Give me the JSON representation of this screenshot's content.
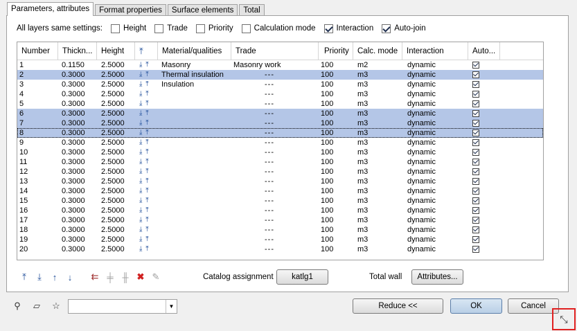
{
  "tabs": [
    "Parameters, attributes",
    "Format properties",
    "Surface elements",
    "Total"
  ],
  "settings": {
    "label": "All layers same settings:",
    "options": [
      {
        "label": "Height",
        "checked": false
      },
      {
        "label": "Trade",
        "checked": false
      },
      {
        "label": "Priority",
        "checked": false
      },
      {
        "label": "Calculation mode",
        "checked": false
      },
      {
        "label": "Interaction",
        "checked": true
      },
      {
        "label": "Auto-join",
        "checked": true
      }
    ]
  },
  "table": {
    "headers": [
      "Number",
      "Thickn...",
      "Height",
      "",
      "Material/qualities",
      "Trade",
      "Priority",
      "Calc. mode",
      "Interaction",
      "Auto..."
    ],
    "rows": [
      {
        "num": "1",
        "th": "0.1150",
        "h": "2.5000",
        "mat": "Masonry",
        "trade": "Masonry work",
        "pr": "100",
        "cm": "m2",
        "int": "dynamic",
        "sel": false
      },
      {
        "num": "2",
        "th": "0.3000",
        "h": "2.5000",
        "mat": "Thermal insulation",
        "trade": "---",
        "pr": "100",
        "cm": "m3",
        "int": "dynamic",
        "sel": true
      },
      {
        "num": "3",
        "th": "0.3000",
        "h": "2.5000",
        "mat": "Insulation",
        "trade": "---",
        "pr": "100",
        "cm": "m3",
        "int": "dynamic",
        "sel": false
      },
      {
        "num": "4",
        "th": "0.3000",
        "h": "2.5000",
        "mat": "",
        "trade": "---",
        "pr": "100",
        "cm": "m3",
        "int": "dynamic",
        "sel": false
      },
      {
        "num": "5",
        "th": "0.3000",
        "h": "2.5000",
        "mat": "",
        "trade": "---",
        "pr": "100",
        "cm": "m3",
        "int": "dynamic",
        "sel": false
      },
      {
        "num": "6",
        "th": "0.3000",
        "h": "2.5000",
        "mat": "",
        "trade": "---",
        "pr": "100",
        "cm": "m3",
        "int": "dynamic",
        "sel": true
      },
      {
        "num": "7",
        "th": "0.3000",
        "h": "2.5000",
        "mat": "",
        "trade": "---",
        "pr": "100",
        "cm": "m3",
        "int": "dynamic",
        "sel": true
      },
      {
        "num": "8",
        "th": "0.3000",
        "h": "2.5000",
        "mat": "",
        "trade": "---",
        "pr": "100",
        "cm": "m3",
        "int": "dynamic",
        "sel": true,
        "focus": true
      },
      {
        "num": "9",
        "th": "0.3000",
        "h": "2.5000",
        "mat": "",
        "trade": "---",
        "pr": "100",
        "cm": "m3",
        "int": "dynamic",
        "sel": false
      },
      {
        "num": "10",
        "th": "0.3000",
        "h": "2.5000",
        "mat": "",
        "trade": "---",
        "pr": "100",
        "cm": "m3",
        "int": "dynamic",
        "sel": false
      },
      {
        "num": "11",
        "th": "0.3000",
        "h": "2.5000",
        "mat": "",
        "trade": "---",
        "pr": "100",
        "cm": "m3",
        "int": "dynamic",
        "sel": false
      },
      {
        "num": "12",
        "th": "0.3000",
        "h": "2.5000",
        "mat": "",
        "trade": "---",
        "pr": "100",
        "cm": "m3",
        "int": "dynamic",
        "sel": false
      },
      {
        "num": "13",
        "th": "0.3000",
        "h": "2.5000",
        "mat": "",
        "trade": "---",
        "pr": "100",
        "cm": "m3",
        "int": "dynamic",
        "sel": false
      },
      {
        "num": "14",
        "th": "0.3000",
        "h": "2.5000",
        "mat": "",
        "trade": "---",
        "pr": "100",
        "cm": "m3",
        "int": "dynamic",
        "sel": false
      },
      {
        "num": "15",
        "th": "0.3000",
        "h": "2.5000",
        "mat": "",
        "trade": "---",
        "pr": "100",
        "cm": "m3",
        "int": "dynamic",
        "sel": false
      },
      {
        "num": "16",
        "th": "0.3000",
        "h": "2.5000",
        "mat": "",
        "trade": "---",
        "pr": "100",
        "cm": "m3",
        "int": "dynamic",
        "sel": false
      },
      {
        "num": "17",
        "th": "0.3000",
        "h": "2.5000",
        "mat": "",
        "trade": "---",
        "pr": "100",
        "cm": "m3",
        "int": "dynamic",
        "sel": false
      },
      {
        "num": "18",
        "th": "0.3000",
        "h": "2.5000",
        "mat": "",
        "trade": "---",
        "pr": "100",
        "cm": "m3",
        "int": "dynamic",
        "sel": false
      },
      {
        "num": "19",
        "th": "0.3000",
        "h": "2.5000",
        "mat": "",
        "trade": "---",
        "pr": "100",
        "cm": "m3",
        "int": "dynamic",
        "sel": false
      },
      {
        "num": "20",
        "th": "0.3000",
        "h": "2.5000",
        "mat": "",
        "trade": "---",
        "pr": "100",
        "cm": "m3",
        "int": "dynamic",
        "sel": false
      }
    ]
  },
  "toolbar": {
    "catalog_label": "Catalog assignment",
    "catalog_button": "katlg1",
    "total_wall_label": "Total wall",
    "attributes_button": "Attributes..."
  },
  "footer": {
    "combo_value": "",
    "reduce_button": "Reduce <<",
    "ok_button": "OK",
    "cancel_button": "Cancel"
  },
  "colors": {
    "selection": "#b4c6e7",
    "icon": "#1f4d99",
    "highlight_box": "#e02020"
  }
}
